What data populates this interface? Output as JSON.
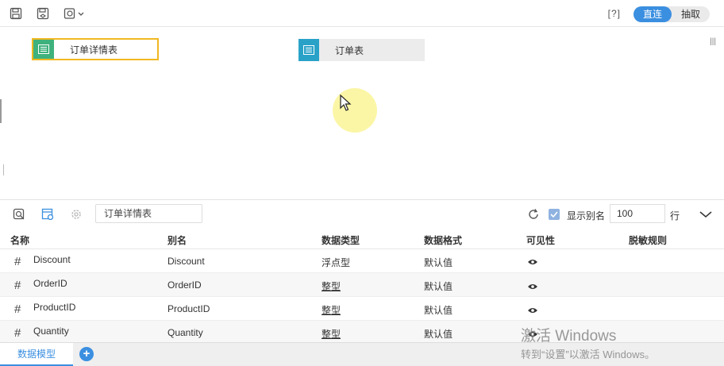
{
  "toolbar": {
    "icons": [
      "save-icon",
      "save-as-icon",
      "settings-dropdown-icon"
    ],
    "help": "[?]",
    "modes": {
      "direct": "直连",
      "extract": "抽取",
      "active": "direct"
    }
  },
  "canvas": {
    "nodes": [
      {
        "label": "订单详情表",
        "icon": "table-icon",
        "selected": true
      },
      {
        "label": "订单表",
        "icon": "table-icon",
        "selected": false
      }
    ],
    "menu_icon": "|||"
  },
  "panel": {
    "table_name": "订单详情表",
    "show_alias_label": "显示别名",
    "show_alias_checked": true,
    "row_count": "100",
    "row_unit": "行",
    "headers": {
      "name": "名称",
      "alias": "别名",
      "type": "数据类型",
      "format": "数据格式",
      "visible": "可见性",
      "mask": "脱敏规则"
    },
    "rows": [
      {
        "name": "Discount",
        "alias": "Discount",
        "type": "浮点型",
        "format": "默认值"
      },
      {
        "name": "OrderID",
        "alias": "OrderID",
        "type": "整型",
        "format": "默认值"
      },
      {
        "name": "ProductID",
        "alias": "ProductID",
        "type": "整型",
        "format": "默认值"
      },
      {
        "name": "Quantity",
        "alias": "Quantity",
        "type": "整型",
        "format": "默认值"
      }
    ]
  },
  "bottom": {
    "tab_label": "数据模型",
    "add_label": "+"
  },
  "watermark": {
    "title": "激活 Windows",
    "subtitle": "转到“设置”以激活 Windows。"
  },
  "colors": {
    "accent": "#3b8fe0",
    "selected_border": "#f0b820"
  }
}
